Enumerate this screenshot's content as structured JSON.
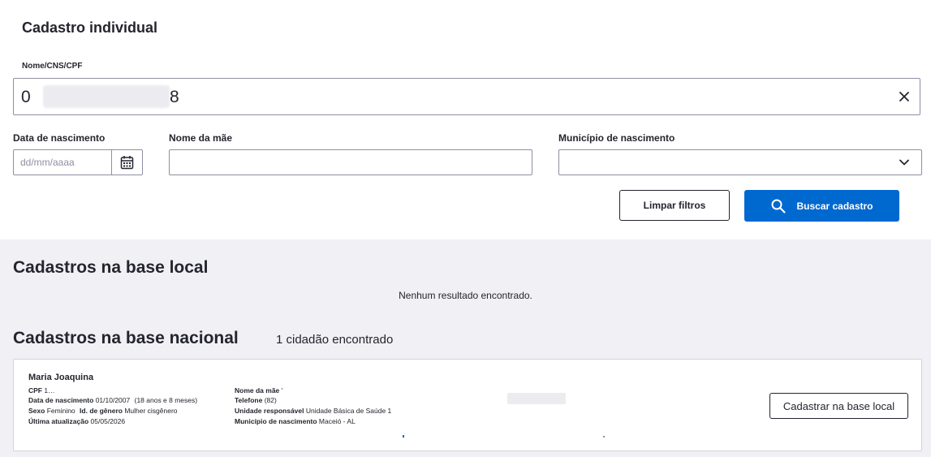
{
  "form": {
    "title": "Cadastro individual",
    "search_label": "Nome/CNS/CPF",
    "search_value_start": "0",
    "search_value_end": "8",
    "birth_label": "Data de nascimento",
    "birth_placeholder": "dd/mm/aaaa",
    "mother_label": "Nome da mãe",
    "city_label": "Município de nascimento",
    "clear_button": "Limpar filtros",
    "search_button": "Buscar cadastro"
  },
  "local": {
    "title": "Cadastros na base local",
    "empty": "Nenhum resultado encontrado."
  },
  "national": {
    "title": "Cadastros na base nacional",
    "count": "1 cidadão encontrado",
    "result": {
      "name": "Maria Joaquina",
      "cpf_label": "CPF",
      "cpf_value": "1…",
      "birth_label": "Data de nascimento",
      "birth_value": "01/10/2007",
      "age": "(18 anos e 8 meses)",
      "sex_label": "Sexo",
      "sex_value": "Feminino",
      "gender_label": "Id. de gênero",
      "gender_value": "Mulher cisgênero",
      "updated_label": "Última atualização",
      "updated_value": "05/05/2026",
      "mother_label": "Nome da mãe",
      "mother_value": "'",
      "phone_label": "Telefone",
      "phone_value": "(82)",
      "unit_label": "Unidade responsável",
      "unit_value": "Unidade Básica de Saúde 1",
      "city_label": "Município de nascimento",
      "city_value": "Maceió - AL",
      "register_button": "Cadastrar na base local"
    }
  },
  "icons": {
    "clear": "close-icon",
    "calendar": "calendar-icon",
    "dropdown": "chevron-down-icon",
    "search": "search-icon"
  },
  "colors": {
    "primary": "#0069d0",
    "background": "#f0f0f5",
    "text": "#24252e"
  }
}
